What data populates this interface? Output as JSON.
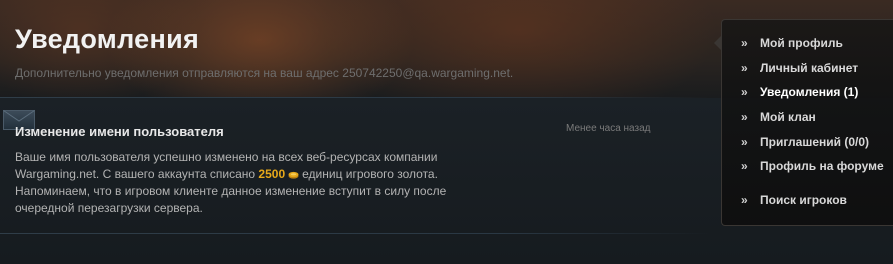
{
  "header": {
    "title": "Уведомления",
    "subtitle": "Дополнительно уведомления отправляются на ваш адрес 250742250@qa.wargaming.net."
  },
  "notification": {
    "title": "Изменение имени пользователя",
    "time": "Менее часа назад",
    "body_part1": "Ваше имя пользователя успешно изменено на всех веб-ресурсах компании Wargaming.net. С вашего аккаунта списано",
    "gold_amount": "2500",
    "body_part2": "единиц игрового золота. Напоминаем, что в игровом клиенте данное изменение вступит в силу после очередной перезагрузки сервера.",
    "icon": "envelope-icon",
    "currency_icon": "gold-coin-icon"
  },
  "sidebar": {
    "items": [
      {
        "label": "Мой профиль",
        "active": false
      },
      {
        "label": "Личный кабинет",
        "active": false
      },
      {
        "label": "Уведомления (1)",
        "active": true
      },
      {
        "label": "Мой клан",
        "active": false
      },
      {
        "label": "Приглашений (0/0)",
        "active": false
      },
      {
        "label": "Профиль на форуме",
        "active": false
      },
      {
        "label": "Поиск игроков",
        "active": false
      }
    ],
    "bullet": "»"
  },
  "colors": {
    "accent_gold": "#e6a81a",
    "background": "#15191d",
    "title_text": "#f2f2f2"
  }
}
